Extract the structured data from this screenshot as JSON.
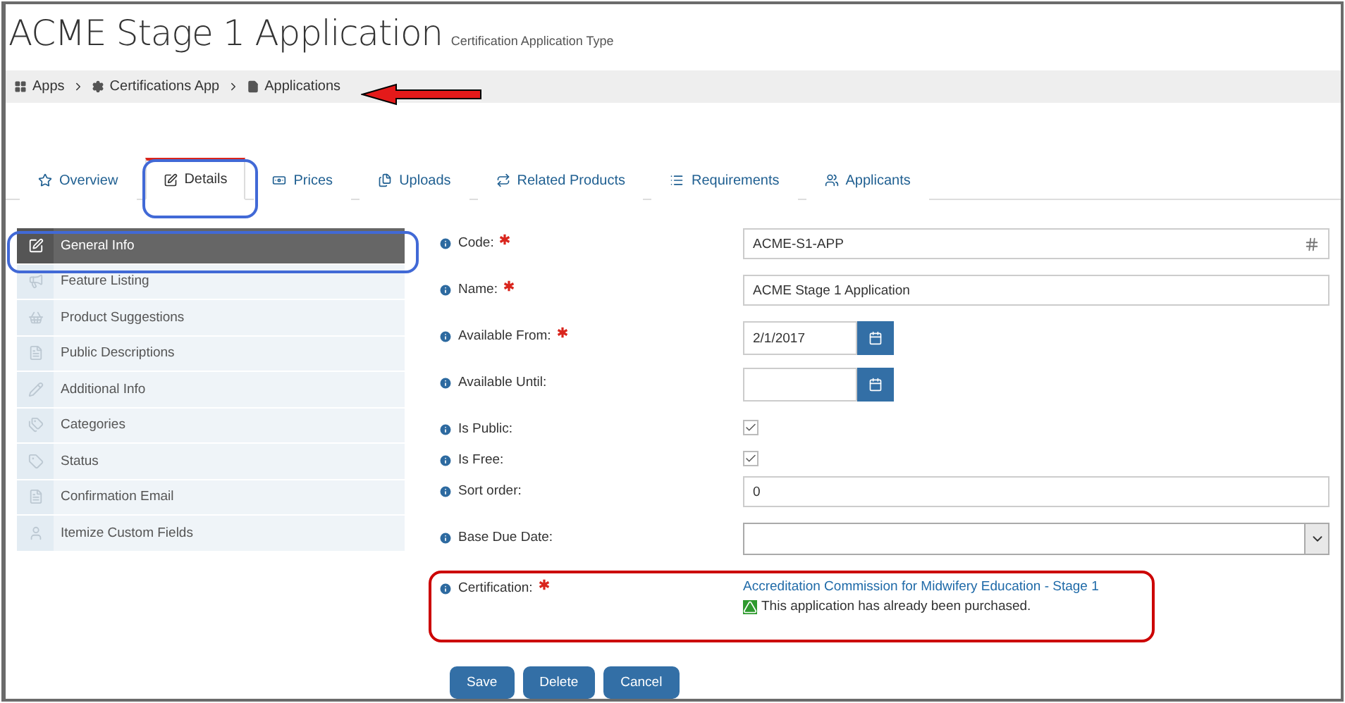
{
  "title": "ACME Stage 1 Application",
  "subtitle": "Certification Application Type",
  "breadcrumb": [
    {
      "label": "Apps"
    },
    {
      "label": "Certifications App"
    },
    {
      "label": "Applications"
    }
  ],
  "tabs": [
    {
      "label": "Overview",
      "selected": false
    },
    {
      "label": "Details",
      "selected": true
    },
    {
      "label": "Prices",
      "selected": false
    },
    {
      "label": "Uploads",
      "selected": false
    },
    {
      "label": "Related Products",
      "selected": false
    },
    {
      "label": "Requirements",
      "selected": false
    },
    {
      "label": "Applicants",
      "selected": false
    }
  ],
  "sidebar": {
    "items": [
      {
        "label": "General Info",
        "selected": true
      },
      {
        "label": "Feature Listing",
        "selected": false
      },
      {
        "label": "Product Suggestions",
        "selected": false
      },
      {
        "label": "Public Descriptions",
        "selected": false
      },
      {
        "label": "Additional Info",
        "selected": false
      },
      {
        "label": "Categories",
        "selected": false
      },
      {
        "label": "Status",
        "selected": false
      },
      {
        "label": "Confirmation Email",
        "selected": false
      },
      {
        "label": "Itemize Custom Fields",
        "selected": false
      }
    ]
  },
  "fields": [
    {
      "kind": "code",
      "label": "Code:",
      "required": true,
      "value": "ACME-S1-APP"
    },
    {
      "kind": "text",
      "label": "Name:",
      "required": true,
      "value": "ACME Stage 1 Application"
    },
    {
      "kind": "date",
      "label": "Available From:",
      "required": true,
      "value": "2/1/2017"
    },
    {
      "kind": "date",
      "label": "Available Until:",
      "required": false
    },
    {
      "kind": "checkbox",
      "label": "Is Public:",
      "required": false,
      "checked": true
    },
    {
      "kind": "checkbox",
      "label": "Is Free:",
      "required": false,
      "checked": true
    },
    {
      "kind": "text",
      "label": "Sort order:",
      "required": false,
      "value": "0"
    },
    {
      "kind": "select",
      "label": "Base Due Date:",
      "required": false
    },
    {
      "kind": "link",
      "label": "Certification:",
      "required": true,
      "value": "Accreditation Commission for Midwifery Education - Stage 1",
      "note": "This application has already been purchased."
    }
  ],
  "buttons": [
    "Save",
    "Delete",
    "Cancel"
  ]
}
